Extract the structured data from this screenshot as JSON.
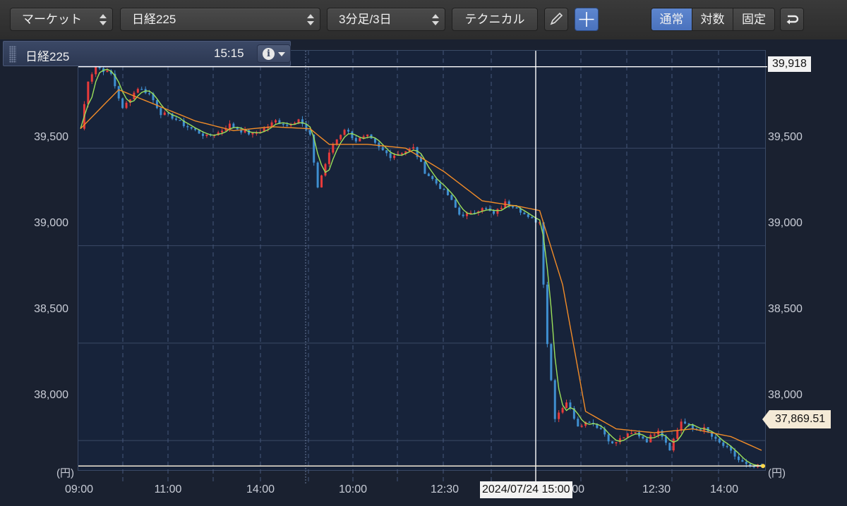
{
  "toolbar": {
    "market_select": "マーケット",
    "symbol_select": "日経225",
    "interval_select": "3分足/3日",
    "technical_button": "テクニカル",
    "pen_icon": "pencil-icon",
    "crosshair_icon": "crosshair-icon",
    "scale_modes": [
      "通常",
      "対数",
      "固定"
    ],
    "active_scale_mode": "通常",
    "undo_icon": "undo-arrow-icon",
    "accent": "#5580c8"
  },
  "info": {
    "title": "日経225",
    "time": "15:15",
    "info_icon": "info-icon",
    "dropdown_icon": "chevron-down-icon"
  },
  "chart_data": {
    "type": "candlestick",
    "y_ticks": [
      "39,500",
      "39,000",
      "38,500",
      "38,000"
    ],
    "y_tick_values": [
      39500,
      39000,
      38500,
      38000
    ],
    "ylim": [
      37780,
      40000
    ],
    "x_ticks": [
      "09:00",
      "11:00",
      "14:00",
      "10:00",
      "12:30",
      "10:00",
      "12:30",
      "14:00"
    ],
    "unit": "(円)",
    "crosshair_price": "39,918",
    "crosshair_price_value": 39918,
    "crosshair_time": "2024/07/24 15:00",
    "last_price": "37,869.51",
    "last_price_value": 37869.51,
    "grid": true,
    "colors": {
      "up": "#e83b3b",
      "down": "#3f8fd0",
      "ma_short": "#9be05a",
      "ma_long": "#f28c28",
      "crosshair": "#ffffff"
    },
    "close_path": [
      [
        0,
        39600
      ],
      [
        2,
        39850
      ],
      [
        4,
        39920
      ],
      [
        8,
        39880
      ],
      [
        11,
        39700
      ],
      [
        13,
        39760
      ],
      [
        15,
        39810
      ],
      [
        18,
        39780
      ],
      [
        21,
        39680
      ],
      [
        24,
        39660
      ],
      [
        27,
        39620
      ],
      [
        30,
        39590
      ],
      [
        33,
        39560
      ],
      [
        36,
        39580
      ],
      [
        39,
        39620
      ],
      [
        42,
        39590
      ],
      [
        45,
        39570
      ],
      [
        48,
        39600
      ],
      [
        51,
        39640
      ],
      [
        54,
        39620
      ],
      [
        57,
        39650
      ],
      [
        60,
        39560
      ],
      [
        62,
        39300
      ],
      [
        64,
        39420
      ],
      [
        66,
        39520
      ],
      [
        69,
        39600
      ],
      [
        72,
        39540
      ],
      [
        75,
        39560
      ],
      [
        78,
        39500
      ],
      [
        81,
        39460
      ],
      [
        84,
        39480
      ],
      [
        87,
        39500
      ],
      [
        90,
        39380
      ],
      [
        93,
        39320
      ],
      [
        96,
        39260
      ],
      [
        99,
        39160
      ],
      [
        102,
        39160
      ],
      [
        105,
        39200
      ],
      [
        108,
        39160
      ],
      [
        111,
        39220
      ],
      [
        114,
        39200
      ],
      [
        117,
        39140
      ],
      [
        120,
        39120
      ],
      [
        122,
        38500
      ],
      [
        124,
        38120
      ],
      [
        127,
        38200
      ],
      [
        130,
        38080
      ],
      [
        133,
        38100
      ],
      [
        136,
        38060
      ],
      [
        139,
        37980
      ],
      [
        142,
        38020
      ],
      [
        145,
        38040
      ],
      [
        148,
        38000
      ],
      [
        151,
        38060
      ],
      [
        154,
        37960
      ],
      [
        157,
        38100
      ],
      [
        160,
        38060
      ],
      [
        163,
        38060
      ],
      [
        166,
        38000
      ],
      [
        169,
        37960
      ],
      [
        172,
        37900
      ],
      [
        175,
        37860
      ],
      [
        178,
        37870
      ]
    ],
    "ma_long_path": [
      [
        0,
        39600
      ],
      [
        10,
        39800
      ],
      [
        20,
        39720
      ],
      [
        30,
        39640
      ],
      [
        40,
        39590
      ],
      [
        50,
        39610
      ],
      [
        60,
        39600
      ],
      [
        65,
        39520
      ],
      [
        75,
        39520
      ],
      [
        85,
        39500
      ],
      [
        95,
        39380
      ],
      [
        105,
        39230
      ],
      [
        115,
        39200
      ],
      [
        120,
        39180
      ],
      [
        126,
        38800
      ],
      [
        132,
        38150
      ],
      [
        140,
        38060
      ],
      [
        150,
        38040
      ],
      [
        160,
        38060
      ],
      [
        170,
        38020
      ],
      [
        178,
        37950
      ]
    ]
  }
}
